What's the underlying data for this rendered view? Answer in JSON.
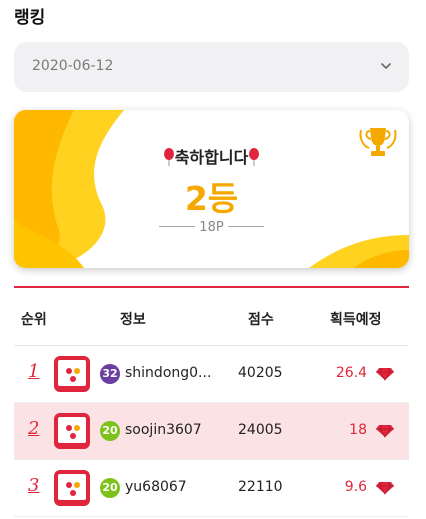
{
  "page_title": "랭킹",
  "date_select": {
    "value": "2020-06-12"
  },
  "banner": {
    "congrats": "축하합니다",
    "rank": "2등",
    "points": "18P"
  },
  "table": {
    "headers": {
      "rank": "순위",
      "info": "정보",
      "score": "점수",
      "reward": "획득예정"
    },
    "rows": [
      {
        "rank": "1",
        "level": "32",
        "level_color": "#6b3fa0",
        "username": "shindong0...",
        "score": "40205",
        "reward": "26.4",
        "highlight": false
      },
      {
        "rank": "2",
        "level": "20",
        "level_color": "#7cc21a",
        "username": "soojin3607",
        "score": "24005",
        "reward": "18",
        "highlight": true
      },
      {
        "rank": "3",
        "level": "20",
        "level_color": "#7cc21a",
        "username": "yu68067",
        "score": "22110",
        "reward": "9.6",
        "highlight": false
      }
    ]
  },
  "colors": {
    "accent": "#e0263c",
    "gold": "#f5a800",
    "highlight_row": "#fbe3e5"
  }
}
